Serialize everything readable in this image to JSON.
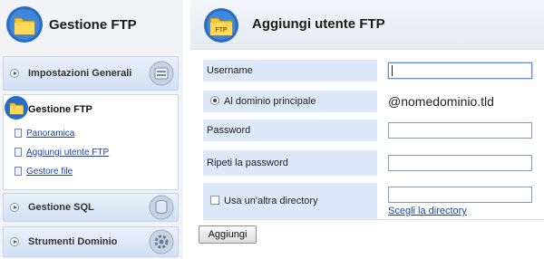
{
  "sidebar": {
    "title": "Gestione FTP",
    "panels": [
      {
        "label": "Impostazioni Generali",
        "icon": "settings-icon"
      },
      {
        "label": "Gestione FTP",
        "icon": "folder-icon",
        "active": true,
        "links": [
          "Panoramica",
          "Aggiungi utente FTP",
          "Gestore file"
        ]
      },
      {
        "label": "Gestione SQL",
        "icon": "database-icon"
      },
      {
        "label": "Strumenti Dominio",
        "icon": "gear-icon"
      }
    ]
  },
  "main": {
    "title": "Aggiungi utente FTP",
    "icon_label": "FTP",
    "form": {
      "username_label": "Username",
      "username_value": "",
      "main_domain_label": "Al dominio principale",
      "domain_suffix": "@nomedominio.tld",
      "password_label": "Password",
      "repeat_password_label": "Ripeti la password",
      "other_directory_label": "Usa un'altra directory",
      "choose_directory_link": "Scegli la directory",
      "submit_label": "Aggiungi"
    }
  },
  "colors": {
    "accent_blue": "#2a6bc4",
    "panel_bg": "#dde9f8",
    "link": "#1f3fa8"
  }
}
